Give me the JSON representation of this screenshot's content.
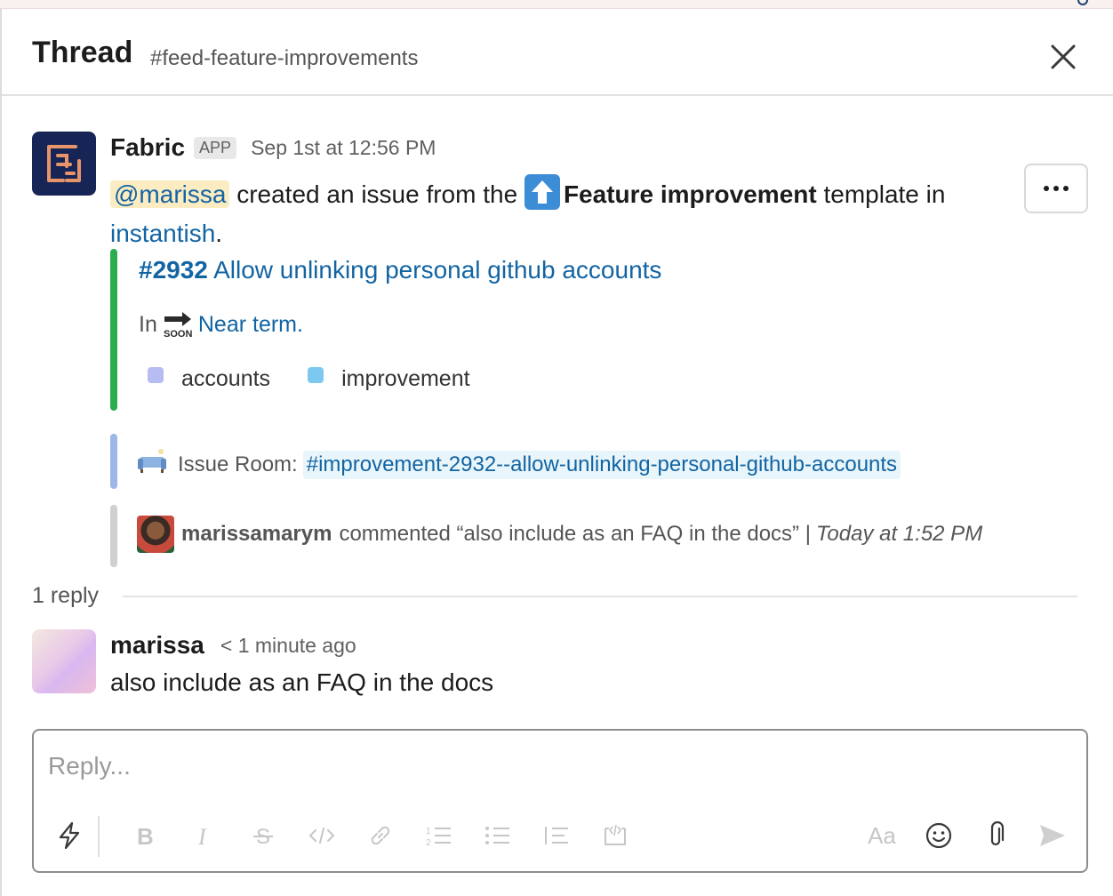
{
  "header": {
    "title": "Thread",
    "channel": "#feed-feature-improvements"
  },
  "message": {
    "sender": "Fabric",
    "badge": "APP",
    "timestamp": "Sep 1st at 12:56 PM",
    "mention": "@marissa",
    "text_1": " created an issue from the ",
    "template_name": "Feature improvement",
    "text_2": " template in",
    "project_link": "instantish",
    "text_3": "."
  },
  "issue": {
    "number": "#2932",
    "title": " Allow unlinking personal github accounts",
    "in_label": "In",
    "status_link": "Near term",
    "status_end": ".",
    "tags": [
      {
        "label": "accounts",
        "color": "#b7bdf2"
      },
      {
        "label": "improvement",
        "color": "#7cc8ef"
      }
    ]
  },
  "room": {
    "label": "Issue Room:",
    "channel": "#improvement-2932--allow-unlinking-personal-github-accounts"
  },
  "comment": {
    "user": "marissamarym",
    "text": "commented “also include as an FAQ in the docs” |",
    "time": "Today at 1:52 PM"
  },
  "replies": {
    "count_label": "1 reply",
    "items": [
      {
        "sender": "marissa",
        "time": "< 1 minute ago",
        "text": "also include as an FAQ in the docs"
      }
    ]
  },
  "composer": {
    "placeholder": "Reply...",
    "format_label": "Aa"
  },
  "icons": {
    "close": "close-icon",
    "more": "more-horizontal-icon",
    "shortcuts": "lightning-icon",
    "bold": "bold-icon",
    "italic": "italic-icon",
    "strike": "strikethrough-icon",
    "code": "code-icon",
    "link": "link-icon",
    "ordered_list": "ordered-list-icon",
    "bullet_list": "bullet-list-icon",
    "quote": "blockquote-icon",
    "code_block": "code-block-icon",
    "emoji": "emoji-icon",
    "attach": "paperclip-icon",
    "send": "send-icon"
  },
  "colors": {
    "link": "#1264a3",
    "issue_bar": "#2bac4f",
    "room_bar": "#9cb7e8",
    "comment_bar": "#d0d0d0",
    "fabric_avatar": "#162555"
  }
}
